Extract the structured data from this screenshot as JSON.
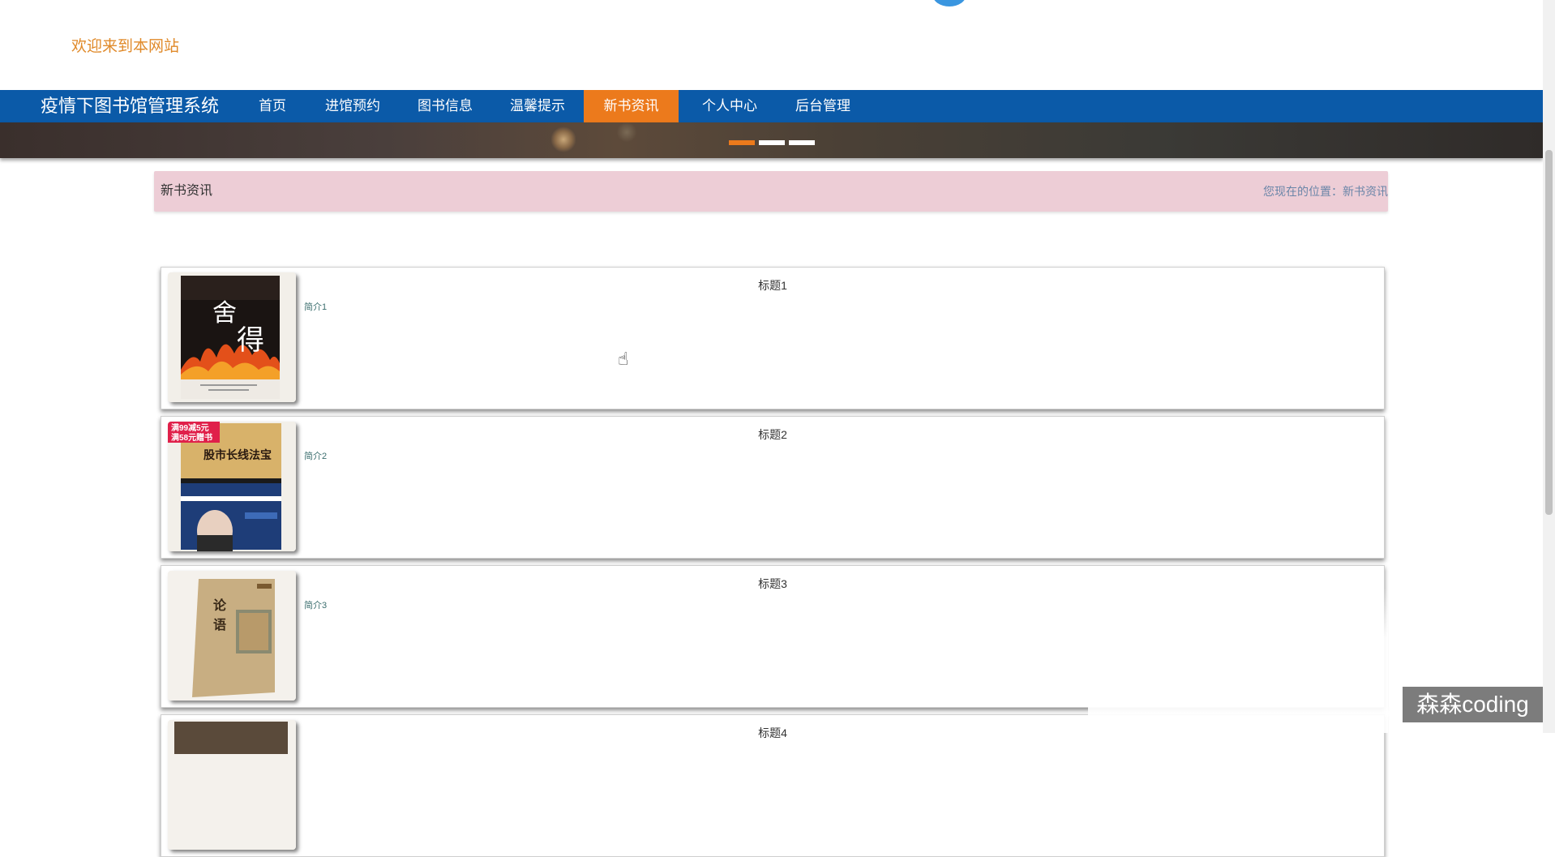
{
  "header": {
    "welcome": "欢迎来到本网站"
  },
  "nav": {
    "brand": "疫情下图书馆管理系统",
    "items": [
      "首页",
      "进馆预约",
      "图书信息",
      "温馨提示",
      "新书资讯",
      "个人中心",
      "后台管理"
    ],
    "active_index": 4
  },
  "banner": {
    "dot_count": 3,
    "active_dot": 0
  },
  "breadcrumb": {
    "title": "新书资讯",
    "prefix": "您现在的位置：",
    "location": "新书资讯"
  },
  "news": [
    {
      "title": "标题1",
      "intro": "简介1",
      "cover_icon": "book-cover-shede"
    },
    {
      "title": "标题2",
      "intro": "简介2",
      "cover_icon": "book-cover-stock-market"
    },
    {
      "title": "标题3",
      "intro": "简介3",
      "cover_icon": "book-cover-lunyu"
    },
    {
      "title": "标题4",
      "intro": "",
      "cover_icon": "book-cover-4"
    }
  ],
  "covers": {
    "cover1": {
      "title_chars": [
        "舍",
        "得"
      ]
    },
    "cover2": {
      "promo_line1": "满99减5元",
      "promo_line2": "满58元赠书",
      "title": "股市长线法宝"
    },
    "cover3": {
      "title_chars": [
        "论",
        "语"
      ]
    }
  },
  "watermark": "森森coding",
  "colors": {
    "nav_bg": "#0b5aa8",
    "accent": "#ec7a1c",
    "crumb_bg": "#edcdd6",
    "welcome": "#e08a2a"
  }
}
